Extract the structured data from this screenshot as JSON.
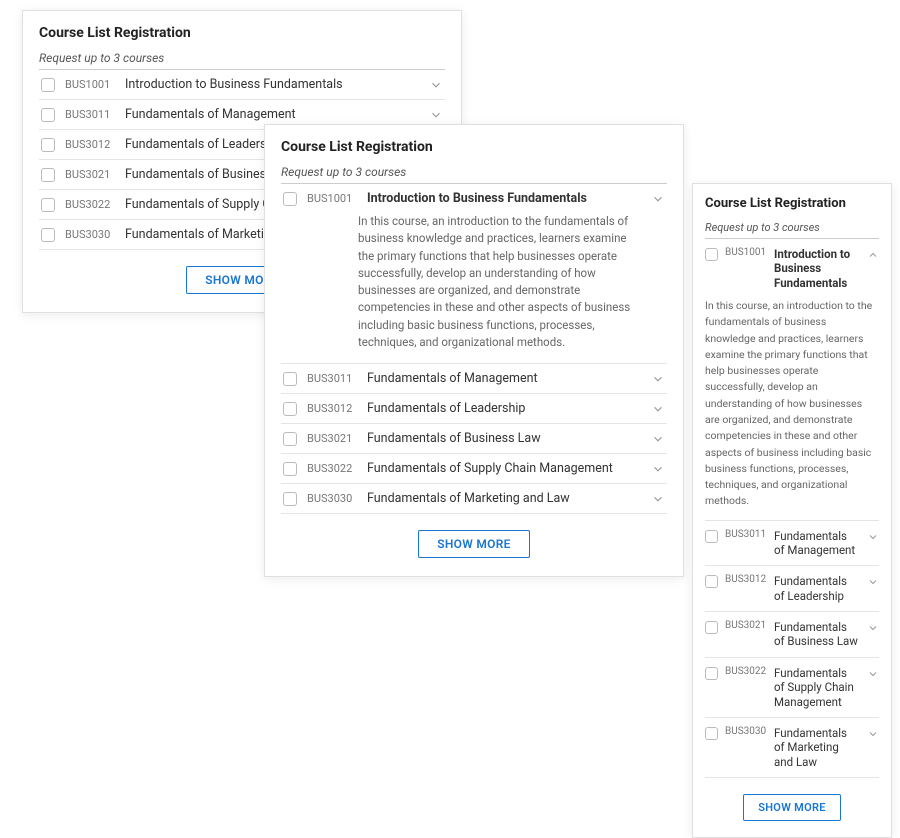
{
  "common": {
    "title": "Course List Registration",
    "subtitle": "Request up to 3 courses",
    "show_more": "SHOW MORE"
  },
  "courses": [
    {
      "code": "BUS1001",
      "title": "Introduction to Business Fundamentals"
    },
    {
      "code": "BUS3011",
      "title": "Fundamentals of Management"
    },
    {
      "code": "BUS3012",
      "title": "Fundamentals of Leadership"
    },
    {
      "code": "BUS3021",
      "title": "Fundamentals of Business Law"
    },
    {
      "code": "BUS3022",
      "title": "Fundamentals of Supply Chain Management"
    },
    {
      "code": "BUS3030",
      "title": "Fundamentals of Marketing and Law"
    }
  ],
  "expanded_description": "In this course, an introduction to the fundamentals of business knowledge and practices, learners examine the primary functions that help businesses operate successfully, develop an understanding of how businesses are organized, and demonstrate competencies in these and other aspects of business including basic business functions, processes, techniques, and organizational methods."
}
